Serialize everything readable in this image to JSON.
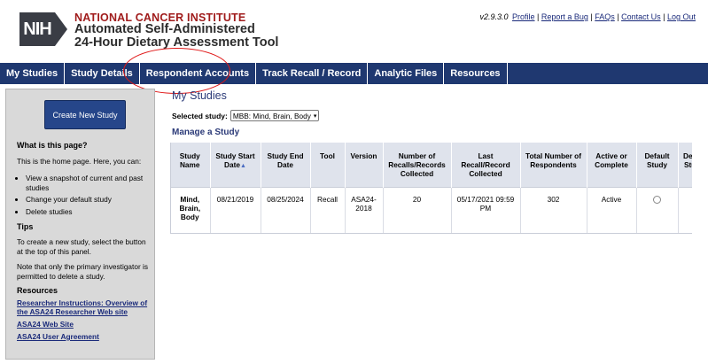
{
  "header": {
    "logo_text": "NIH",
    "org_name": "NATIONAL CANCER INSTITUTE",
    "title_line1": "Automated Self-Administered",
    "title_line2": "24-Hour Dietary Assessment Tool",
    "version": "v2.9.3.0",
    "links": [
      "Profile",
      "Report a Bug",
      "FAQs",
      "Contact Us",
      "Log Out"
    ]
  },
  "nav": {
    "items": [
      "My Studies",
      "Study Details",
      "Respondent Accounts",
      "Track Recall / Record",
      "Analytic Files",
      "Resources"
    ]
  },
  "sidebar": {
    "create_button": "Create New Study",
    "what_heading": "What is this page?",
    "what_text": "This is the home page. Here, you can:",
    "what_list": [
      "View a snapshot of current and past studies",
      "Change your default study",
      "Delete studies"
    ],
    "tips_heading": "Tips",
    "tips_text1": "To create a new study, select the button at the top of this panel.",
    "tips_text2": "Note that only the primary investigator is permitted to delete a study.",
    "resources_heading": "Resources",
    "resource_links": [
      "Researcher Instructions: Overview of the ASA24 Researcher Web site",
      "ASA24 Web Site",
      "ASA24 User Agreement"
    ]
  },
  "main": {
    "title": "My Studies",
    "selected_label": "Selected study:",
    "selected_value": "MBB: Mind, Brain, Body",
    "manage_title": "Manage a Study",
    "table": {
      "headers": [
        "Study Name",
        "Study Start Date",
        "Study End Date",
        "Tool",
        "Version",
        "Number of Recalls/Records Collected",
        "Last Recall/Record Collected",
        "Total Number of Respondents",
        "Active or Complete",
        "Default Study",
        "Delete Study"
      ],
      "rows": [
        {
          "name": "Mind, Brain, Body",
          "start": "08/21/2019",
          "end": "08/25/2024",
          "tool": "Recall",
          "version": "ASA24-2018",
          "num_recalls": "20",
          "last_recall": "05/17/2021 09:59 PM",
          "total_respondents": "302",
          "status": "Active"
        }
      ]
    }
  }
}
